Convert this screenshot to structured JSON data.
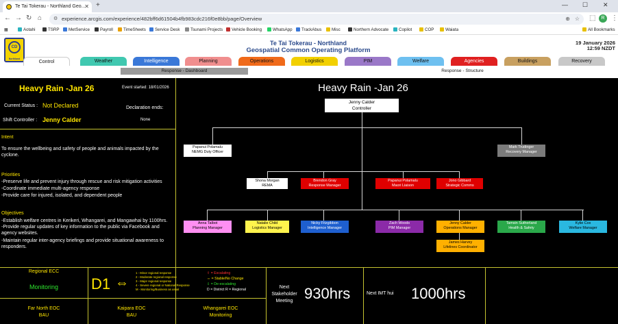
{
  "browser": {
    "tab_title": "Te Tai Tokerau - Northland Geo...",
    "url": "experience.arcgis.com/experience/482bff6d61504b4fb983cdc216f0e8bb/page/Overview",
    "bookmarks": [
      "Aotahi",
      "TSRP",
      "MetService",
      "Payroll",
      "TimeSheets",
      "Service Desk",
      "Tsunami Projects",
      "Vehicle Booking",
      "WhatsApp",
      "TrackAbus",
      "Misc",
      "Northern Advocate",
      "Copilot",
      "COP",
      "Waiata"
    ],
    "all_bookmarks": "All Bookmarks",
    "profile_initial": "R",
    "colors": {
      "tabbar": "#dfe3eb",
      "urlbox": "#eef1f6"
    }
  },
  "header": {
    "logo_text": "CD",
    "logo_sub": "Northland",
    "title_line1": "Te Tai Tokerau - Northland",
    "title_line2": "Geospatial Common Operating Platform",
    "date": "19 January 2026",
    "time": "12:59 NZDT"
  },
  "tabs": [
    {
      "label": "Control",
      "color": "#ffffff"
    },
    {
      "label": "Weather",
      "color": "#40c8b0"
    },
    {
      "label": "Intelligence",
      "color": "#3a78d8"
    },
    {
      "label": "Planning",
      "color": "#f08e8e"
    },
    {
      "label": "Operations",
      "color": "#f06a1a"
    },
    {
      "label": "Logistics",
      "color": "#f2d000"
    },
    {
      "label": "PIM",
      "color": "#9a78c8"
    },
    {
      "label": "Welfare",
      "color": "#6ec0f0"
    },
    {
      "label": "Agencies",
      "color": "#e02020"
    },
    {
      "label": "Buildings",
      "color": "#c8a060"
    },
    {
      "label": "Recovery",
      "color": "#c8c8c8"
    }
  ],
  "subnav": {
    "left": "Response - Dashboard",
    "right": "Response - Structure"
  },
  "left_panel": {
    "event_title": "Heavy Rain -Jan 26",
    "event_started": "Event started: 18/01/2026",
    "current_status_label": "Current Status :",
    "current_status_value": "Not Declared",
    "declaration_label": "Declaration ends:",
    "declaration_value": "None",
    "shift_controller_label": "Shift Controller :",
    "shift_controller_value": "Jenny Calder",
    "intent_heading": "Intent",
    "intent_text": "To ensure the wellbeing and safety of people and animals impacted by the cyclone.",
    "priorities_heading": "Priorities",
    "priorities": [
      "-Preserve life and prevent injury through rescue and risk mitigation activities",
      "-Coordinate immediate multi-agency response",
      "-Provide care for injured, isolated, and dependent people"
    ],
    "objectives_heading": "Objectives",
    "objectives": [
      "-Establish welfare centres in Kerikeri, Whangarei, and Mangawhai by 1100hrs.",
      "-Provide regular updates of key information to the public via Facebook and agency websites.",
      "-Maintain regular inter-agency briefings and provide situational awareness to responders."
    ]
  },
  "structure": {
    "title": "Heavy Rain -Jan 26",
    "controller": {
      "name": "Jenny Calder",
      "role": "Controller"
    },
    "nemg": {
      "name": "Papanui Polamalu",
      "role": "NEMG Duty Officer"
    },
    "recovery": {
      "name": "Mark Trudinger",
      "role": "Recovery Manager"
    },
    "row2": [
      {
        "name": "Shona Morgan",
        "role": "REMA"
      },
      {
        "name": "Brendon Gray",
        "role": "Response Manager"
      },
      {
        "name": "Papanui Polamalu",
        "role": "Maori Liaison"
      },
      {
        "name": "Jono Gibbard",
        "role": "Strategic Comms"
      }
    ],
    "row3": [
      {
        "name": "Anna Talbot",
        "role": "Planning Manager"
      },
      {
        "name": "Natalie Child",
        "role": "Logistics Manager"
      },
      {
        "name": "Nicky Fitzgibbon",
        "role": "Intelligence Manager"
      },
      {
        "name": "Zach Woods",
        "role": "PIM Manager"
      },
      {
        "name": "Jenny Calder",
        "role": "Operations Manager"
      },
      {
        "name": "Tamsin Sutherland",
        "role": "Health & Safety"
      },
      {
        "name": "Kylie Cox",
        "role": "Welfare Manager"
      }
    ],
    "lifelines": {
      "name": "James Harvey",
      "role": "Lifelines Coordinator"
    }
  },
  "bottom": {
    "regional_ecc_label": "Regional ECC",
    "regional_ecc_status": "Monitoring",
    "level_code": "D1",
    "level_legend": [
      "1 - Minor regional response",
      "2 - Moderate regional response",
      "3 - Major regional response",
      "4 - Severe regional or National Response",
      "M - Monitoring/Business as usual"
    ],
    "trend_legend": [
      "= Escalating",
      "= Stable/No Change",
      "= De-escalating",
      "D = District R = Regional"
    ],
    "next_meeting_label": "Next Stakeholder Meeting",
    "next_meeting_time": "930hrs",
    "next_imt_label": "Next IMT hui",
    "next_imt_time": "1000hrs",
    "eocs": [
      {
        "name": "Far North EOC",
        "status": "BAU"
      },
      {
        "name": "Kaipara EOC",
        "status": "BAU"
      },
      {
        "name": "Whangarei EOC",
        "status": "Monitoring"
      }
    ]
  }
}
